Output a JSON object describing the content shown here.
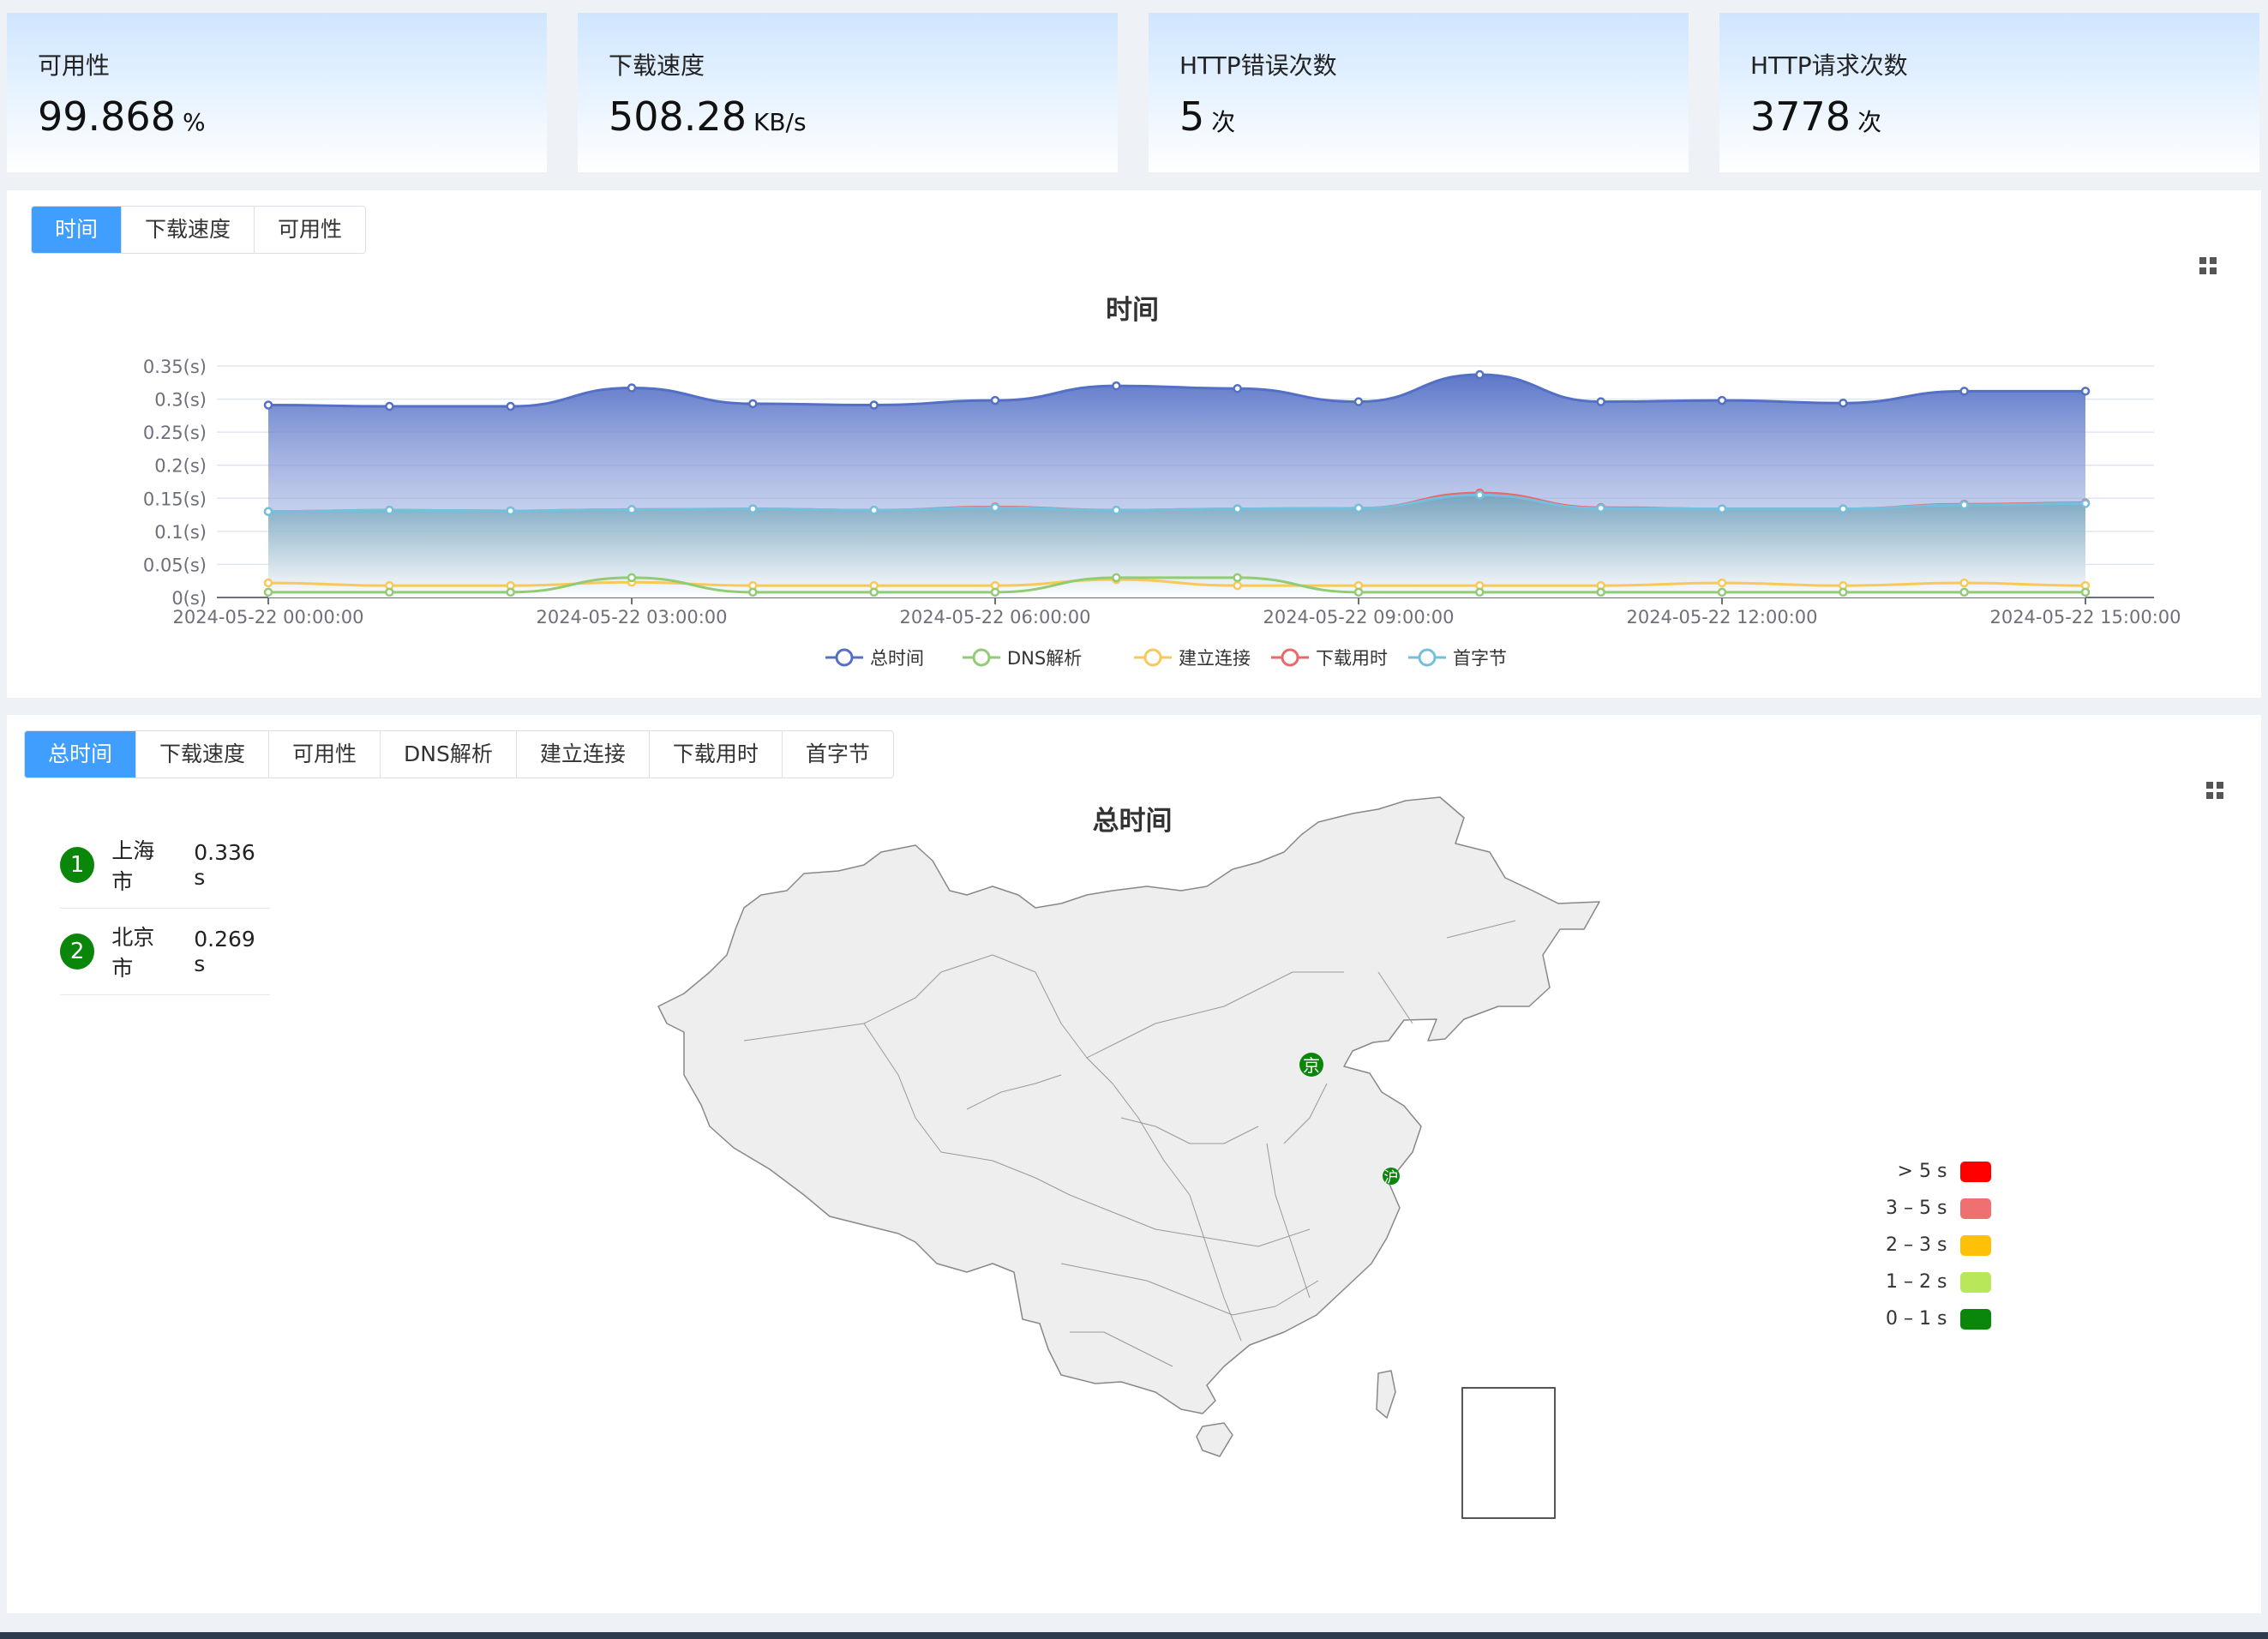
{
  "stats": [
    {
      "label": "可用性",
      "value": "99.868",
      "unit": "%"
    },
    {
      "label": "下载速度",
      "value": "508.28",
      "unit": "KB/s"
    },
    {
      "label": "HTTP错误次数",
      "value": "5",
      "unit": "次"
    },
    {
      "label": "HTTP请求次数",
      "value": "3778",
      "unit": "次"
    }
  ],
  "top_tabs": [
    "时间",
    "下载速度",
    "可用性"
  ],
  "bottom_tabs": [
    "总时间",
    "下载速度",
    "可用性",
    "DNS解析",
    "建立连接",
    "下载用时",
    "首字节"
  ],
  "chart_data": {
    "type": "area",
    "title": "时间",
    "x": [
      "2024-05-22 00:00:00",
      "2024-05-22 01:00:00",
      "2024-05-22 02:00:00",
      "2024-05-22 03:00:00",
      "2024-05-22 04:00:00",
      "2024-05-22 05:00:00",
      "2024-05-22 06:00:00",
      "2024-05-22 07:00:00",
      "2024-05-22 08:00:00",
      "2024-05-22 09:00:00",
      "2024-05-22 10:00:00",
      "2024-05-22 11:00:00",
      "2024-05-22 12:00:00",
      "2024-05-22 13:00:00",
      "2024-05-22 14:00:00",
      "2024-05-22 15:00:00"
    ],
    "x_tick_labels": [
      "2024-05-22 00:00:00",
      "2024-05-22 03:00:00",
      "2024-05-22 06:00:00",
      "2024-05-22 09:00:00",
      "2024-05-22 12:00:00",
      "2024-05-22 15:00:00"
    ],
    "y_tick_labels": [
      "0(s)",
      "0.05(s)",
      "0.1(s)",
      "0.15(s)",
      "0.2(s)",
      "0.25(s)",
      "0.3(s)",
      "0.35(s)"
    ],
    "ylim": [
      0,
      0.35
    ],
    "legend_position": "bottom",
    "series": [
      {
        "name": "总时间",
        "color": "#5470c6",
        "values": [
          0.291,
          0.289,
          0.289,
          0.317,
          0.293,
          0.291,
          0.298,
          0.32,
          0.316,
          0.296,
          0.337,
          0.296,
          0.298,
          0.294,
          0.312,
          0.312
        ]
      },
      {
        "name": "DNS解析",
        "color": "#91cc75",
        "values": [
          0.008,
          0.008,
          0.008,
          0.03,
          0.008,
          0.008,
          0.008,
          0.03,
          0.03,
          0.008,
          0.008,
          0.008,
          0.008,
          0.008,
          0.008,
          0.008
        ]
      },
      {
        "name": "建立连接",
        "color": "#fac858",
        "values": [
          0.022,
          0.018,
          0.018,
          0.023,
          0.018,
          0.018,
          0.018,
          0.027,
          0.018,
          0.018,
          0.018,
          0.018,
          0.022,
          0.018,
          0.022,
          0.018
        ]
      },
      {
        "name": "下载用时",
        "color": "#ee6666",
        "values": [
          0.13,
          0.132,
          0.131,
          0.133,
          0.134,
          0.132,
          0.137,
          0.132,
          0.134,
          0.135,
          0.158,
          0.136,
          0.134,
          0.134,
          0.141,
          0.143
        ]
      },
      {
        "name": "首字节",
        "color": "#73c0de",
        "values": [
          0.13,
          0.132,
          0.131,
          0.133,
          0.134,
          0.132,
          0.136,
          0.132,
          0.134,
          0.135,
          0.155,
          0.135,
          0.134,
          0.134,
          0.14,
          0.142
        ]
      }
    ]
  },
  "map": {
    "title": "总时间",
    "ranking": [
      {
        "rank": "1",
        "city": "上海市",
        "value": "0.336 s"
      },
      {
        "rank": "2",
        "city": "北京市",
        "value": "0.269 s"
      }
    ],
    "markers": [
      {
        "text": "京",
        "color": "#0a870a"
      },
      {
        "text": "沪",
        "color": "#0a870a"
      }
    ],
    "legend": [
      {
        "label": "> 5 s",
        "color": "#ff0000"
      },
      {
        "label": "3 – 5 s",
        "color": "#ee7070"
      },
      {
        "label": "2 – 3 s",
        "color": "#ffc107"
      },
      {
        "label": "1 – 2 s",
        "color": "#b8e85a"
      },
      {
        "label": "0 – 1 s",
        "color": "#0a870a"
      }
    ]
  }
}
